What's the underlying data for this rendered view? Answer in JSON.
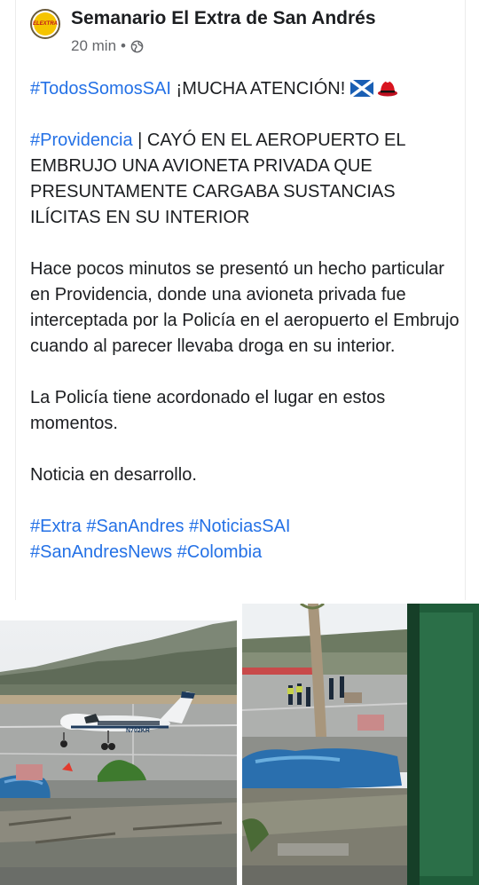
{
  "post": {
    "page_name": "Semanario El Extra de San Andrés",
    "avatar_text": "ELEXTRA",
    "timestamp": "20 min",
    "separator": "•",
    "privacy_icon": "globe-icon",
    "line1_tag": "#TodosSomosSAI",
    "line1_text": " ¡MUCHA ATENCIÓN! ",
    "line1_icons": [
      "flag-scotland-icon",
      "red-hat-icon"
    ],
    "headline_tag": "#Providencia",
    "headline_text": " | CAYÓ EN EL AEROPUERTO EL EMBRUJO UNA AVIONETA PRIVADA QUE PRESUNTAMENTE CARGABA SUSTANCIAS ILÍCITAS EN SU INTERIOR",
    "paragraph1": "Hace pocos minutos se presentó un hecho particular en Providencia, donde una avioneta privada fue interceptada por la Policía en el aeropuerto el Embrujo cuando al parecer llevaba droga en su interior.",
    "paragraph2": "La Policía tiene acordonado el lugar en estos momentos.",
    "paragraph3": "Noticia en desarrollo.",
    "hashtags_line1": "#Extra #SanAndres #NoticiasSAI",
    "hashtags_line2": "#SanAndresNews #Colombia",
    "plane_registration": "N702KR"
  },
  "colors": {
    "hashtag": "#2471e6",
    "text": "#1c1e21",
    "meta": "#65676b"
  }
}
